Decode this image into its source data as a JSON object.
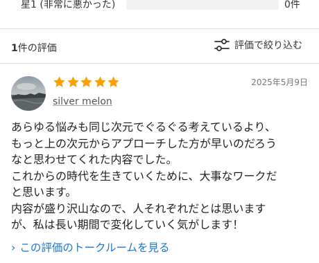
{
  "rating_distribution": {
    "row": {
      "label": "星1 (非常に悪かった)",
      "count": "0件",
      "fraction": 0
    }
  },
  "review_summary": {
    "count_number": "1",
    "count_suffix": "件の評価",
    "filter_label": "評価で絞り込む"
  },
  "review": {
    "rating": 5,
    "max_rating": 5,
    "date": "2025年5月9日",
    "reviewer_name": "silver melon",
    "body_lines": [
      "あらゆる悩みも同じ次元でぐるぐる考えているより、",
      "もっと上の次元からアプローチした方が早いのだろう",
      "なと思わせてくれた内容でした。",
      "これからの時代を生きていくために、大事なワークだ",
      "と思います。",
      "内容が盛り沢山なので、人それぞれだとは思います",
      "が、私は長い期間で変化していく気がします！"
    ],
    "talkroom_link": "この評価のトークルームを見る"
  },
  "colors": {
    "star": "#f7a200",
    "link": "#1a75d1",
    "divider": "#dcdcdc"
  },
  "icons": {
    "filter": "filter-sliders-icon",
    "star": "star-icon",
    "chevron": "chevron-right-icon"
  }
}
